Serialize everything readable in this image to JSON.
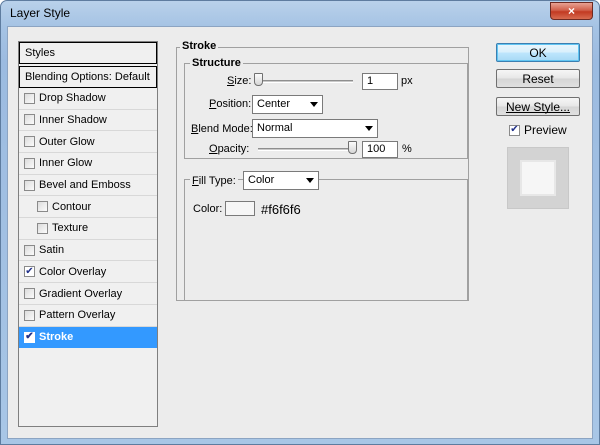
{
  "window": {
    "title": "Layer Style",
    "close_glyph": "×"
  },
  "styles_list": {
    "header": "Styles",
    "blending_options": "Blending Options: Default",
    "items": [
      {
        "label": "Drop Shadow",
        "checked": false,
        "indent": false,
        "selected": false
      },
      {
        "label": "Inner Shadow",
        "checked": false,
        "indent": false,
        "selected": false
      },
      {
        "label": "Outer Glow",
        "checked": false,
        "indent": false,
        "selected": false
      },
      {
        "label": "Inner Glow",
        "checked": false,
        "indent": false,
        "selected": false
      },
      {
        "label": "Bevel and Emboss",
        "checked": false,
        "indent": false,
        "selected": false
      },
      {
        "label": "Contour",
        "checked": false,
        "indent": true,
        "selected": false
      },
      {
        "label": "Texture",
        "checked": false,
        "indent": true,
        "selected": false
      },
      {
        "label": "Satin",
        "checked": false,
        "indent": false,
        "selected": false
      },
      {
        "label": "Color Overlay",
        "checked": true,
        "indent": false,
        "selected": false
      },
      {
        "label": "Gradient Overlay",
        "checked": false,
        "indent": false,
        "selected": false
      },
      {
        "label": "Pattern Overlay",
        "checked": false,
        "indent": false,
        "selected": false
      },
      {
        "label": "Stroke",
        "checked": true,
        "indent": false,
        "selected": true
      }
    ]
  },
  "stroke": {
    "group_title": "Stroke",
    "structure_title": "Structure",
    "size_label_key": "S",
    "size_label_rest": "ize:",
    "size_value": "1",
    "size_unit": "px",
    "size_level_percent": 0,
    "position_label_key": "P",
    "position_label_rest": "osition:",
    "position_value": "Center",
    "blend_label_key": "B",
    "blend_label_rest": "lend Mode:",
    "blend_value": "Normal",
    "opacity_label_key": "O",
    "opacity_label_rest": "pacity:",
    "opacity_value": "100",
    "opacity_unit": "%",
    "opacity_level_percent": 100,
    "fill_type_label_key": "F",
    "fill_type_label_rest": "ill Type:",
    "fill_type_value": "Color",
    "color_label": "Color:",
    "color_hex_text": "#f6f6f6",
    "color_swatch": "#f6f6f6"
  },
  "buttons": {
    "ok": "OK",
    "reset": "Reset",
    "new_style": "New Style...",
    "preview_label": "Preview",
    "preview_checked": true
  },
  "colors": {
    "selection_bg": "#3399ff",
    "window_frame": "#a5c3e4",
    "close_button": "#c23a22"
  }
}
